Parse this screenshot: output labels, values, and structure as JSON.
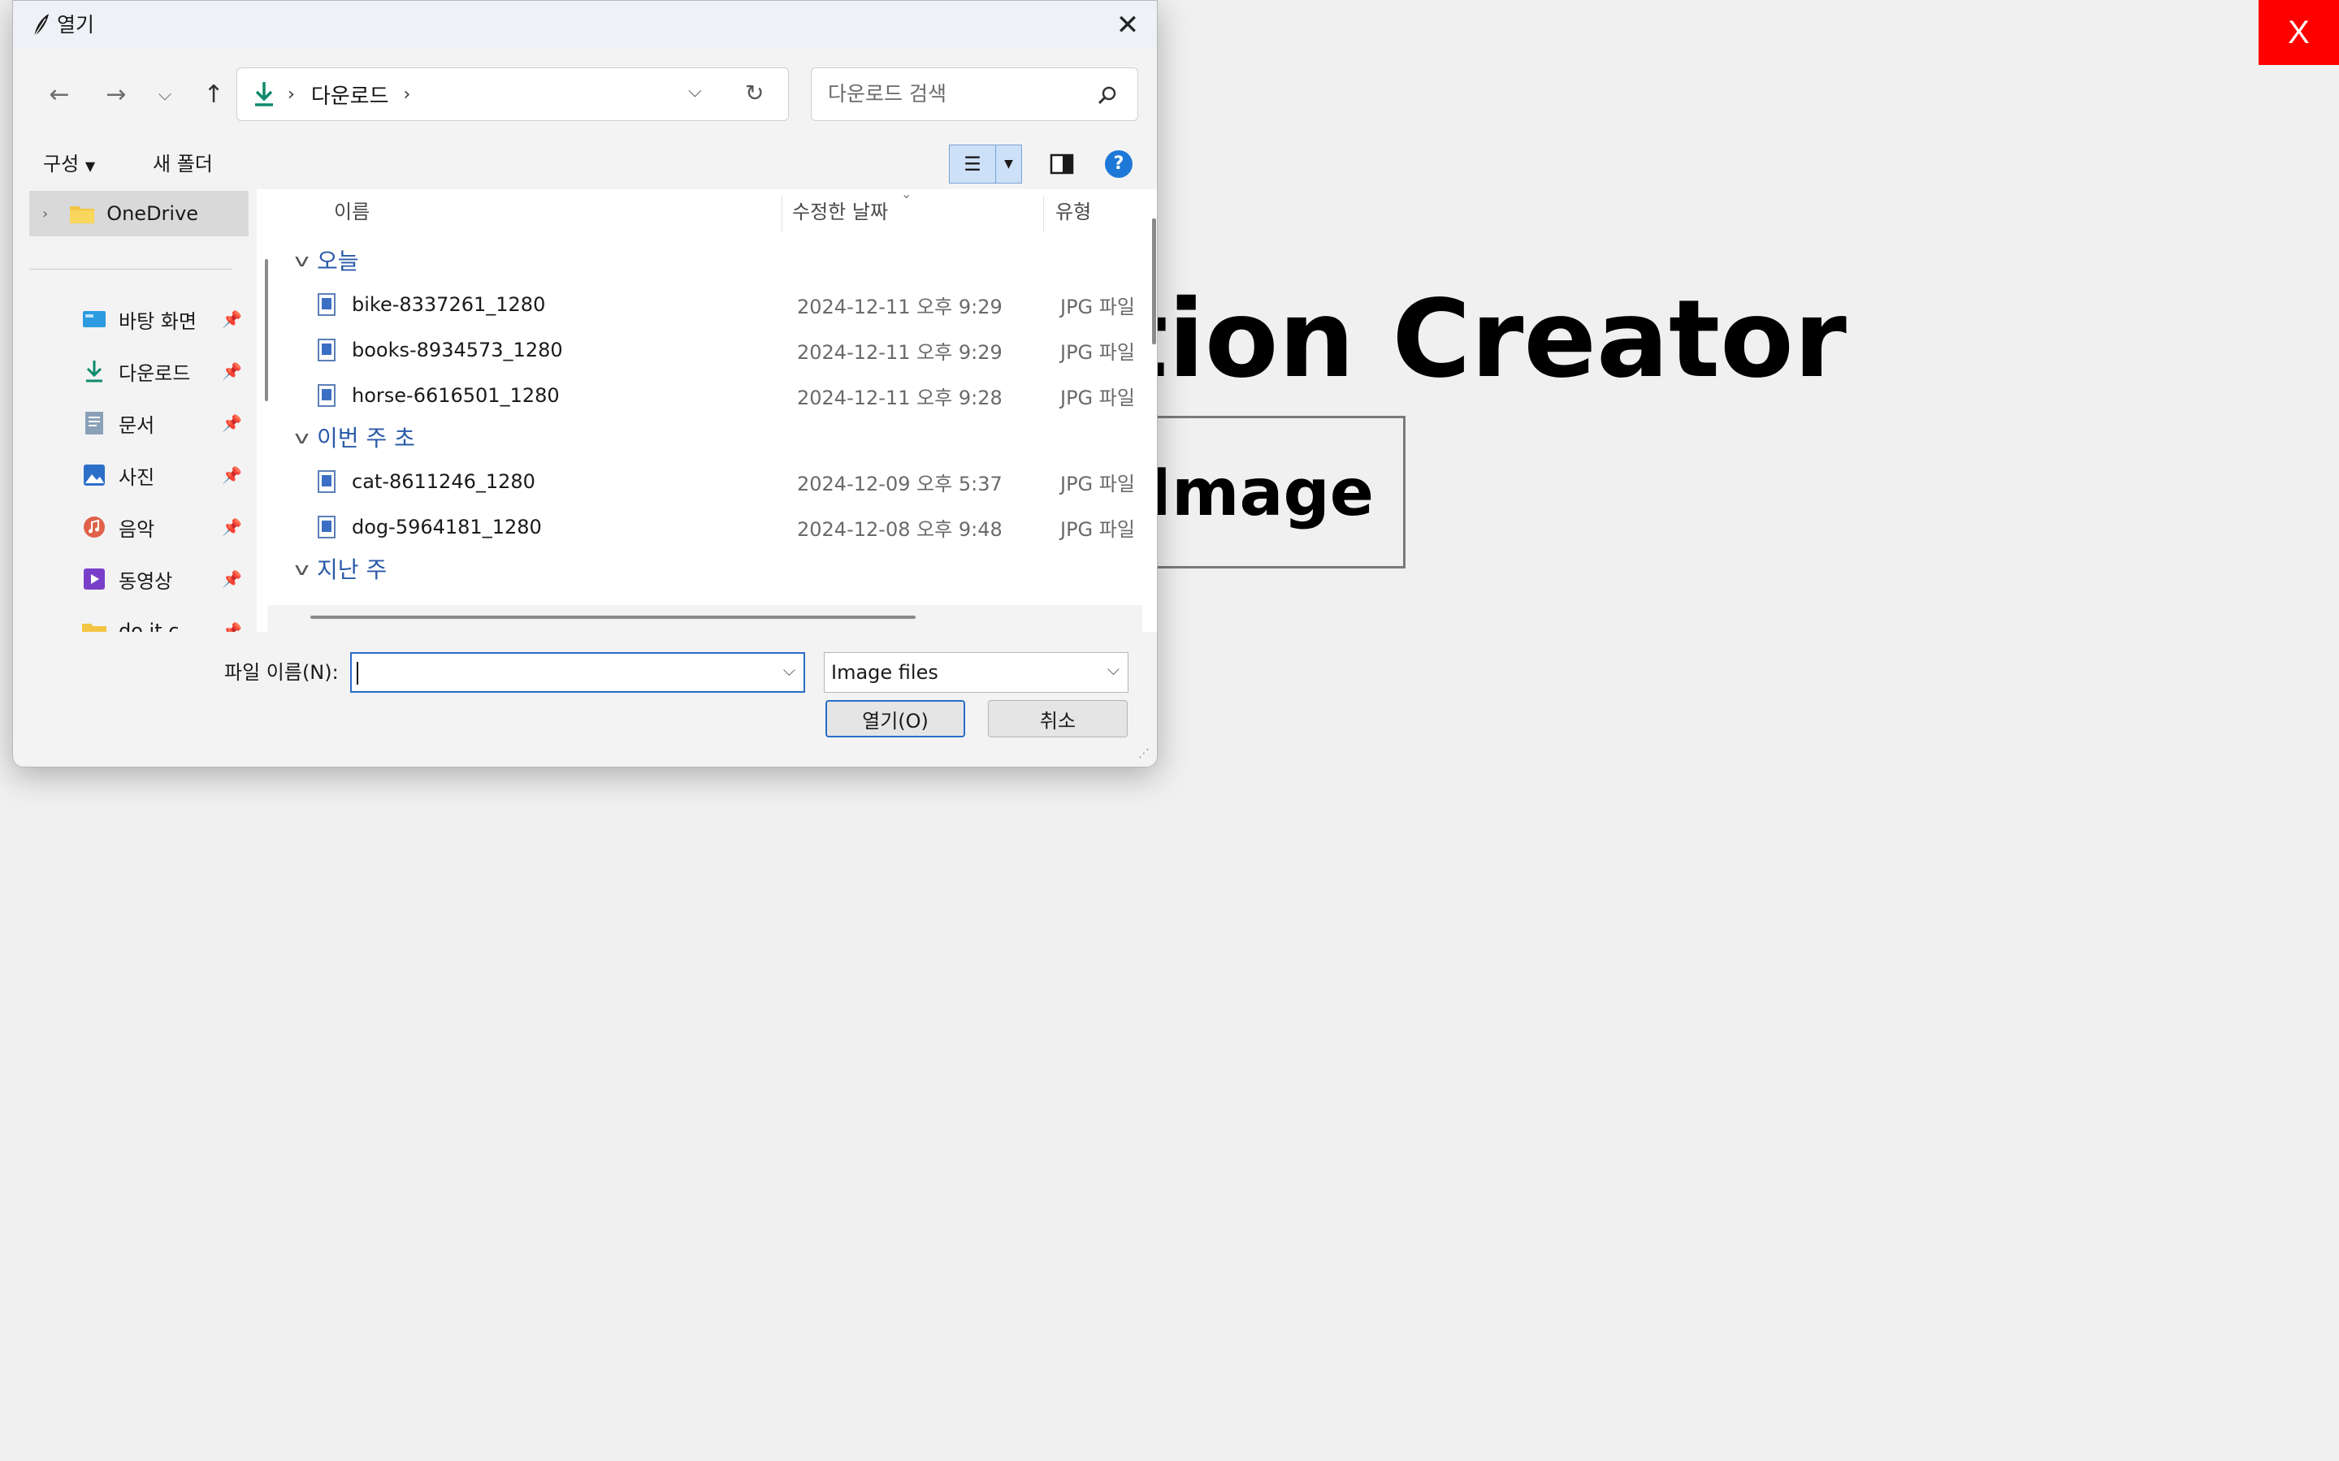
{
  "app": {
    "title_visible": "ption Creator",
    "upload_button_visible": "d Image",
    "close_label": "X",
    "close_color": "#ff0000"
  },
  "dialog": {
    "title": "열기",
    "address": {
      "folder": "다운로드",
      "sep": "›"
    },
    "search_placeholder": "다운로드 검색",
    "toolbar": {
      "organize": "구성",
      "new_folder": "새 폴더"
    },
    "sidebar": [
      {
        "label": "OneDrive",
        "icon": "folder-icon",
        "pinned": false,
        "selected": true
      },
      {
        "label": "바탕 화면",
        "icon": "desktop-icon",
        "pinned": true
      },
      {
        "label": "다운로드",
        "icon": "download-icon",
        "pinned": true
      },
      {
        "label": "문서",
        "icon": "document-icon",
        "pinned": true
      },
      {
        "label": "사진",
        "icon": "pictures-icon",
        "pinned": true
      },
      {
        "label": "음악",
        "icon": "music-icon",
        "pinned": true
      },
      {
        "label": "동영상",
        "icon": "video-icon",
        "pinned": true
      },
      {
        "label": "do it c",
        "icon": "folder-icon",
        "pinned": true
      }
    ],
    "columns": {
      "name": "이름",
      "modified": "수정한 날짜",
      "type": "유형"
    },
    "groups": [
      {
        "label": "오늘",
        "files": [
          {
            "name": "bike-8337261_1280",
            "modified": "2024-12-11 오후 9:29",
            "type": "JPG 파일"
          },
          {
            "name": "books-8934573_1280",
            "modified": "2024-12-11 오후 9:29",
            "type": "JPG 파일"
          },
          {
            "name": "horse-6616501_1280",
            "modified": "2024-12-11 오후 9:28",
            "type": "JPG 파일"
          }
        ]
      },
      {
        "label": "이번 주 초",
        "files": [
          {
            "name": "cat-8611246_1280",
            "modified": "2024-12-09 오후 5:37",
            "type": "JPG 파일"
          },
          {
            "name": "dog-5964181_1280",
            "modified": "2024-12-08 오후 9:48",
            "type": "JPG 파일"
          }
        ]
      },
      {
        "label": "지난 주",
        "files": []
      }
    ],
    "footer": {
      "filename_label": "파일 이름(N):",
      "filename_value": "",
      "filetype": "Image files",
      "open_label": "열기(O)",
      "cancel_label": "취소"
    }
  }
}
